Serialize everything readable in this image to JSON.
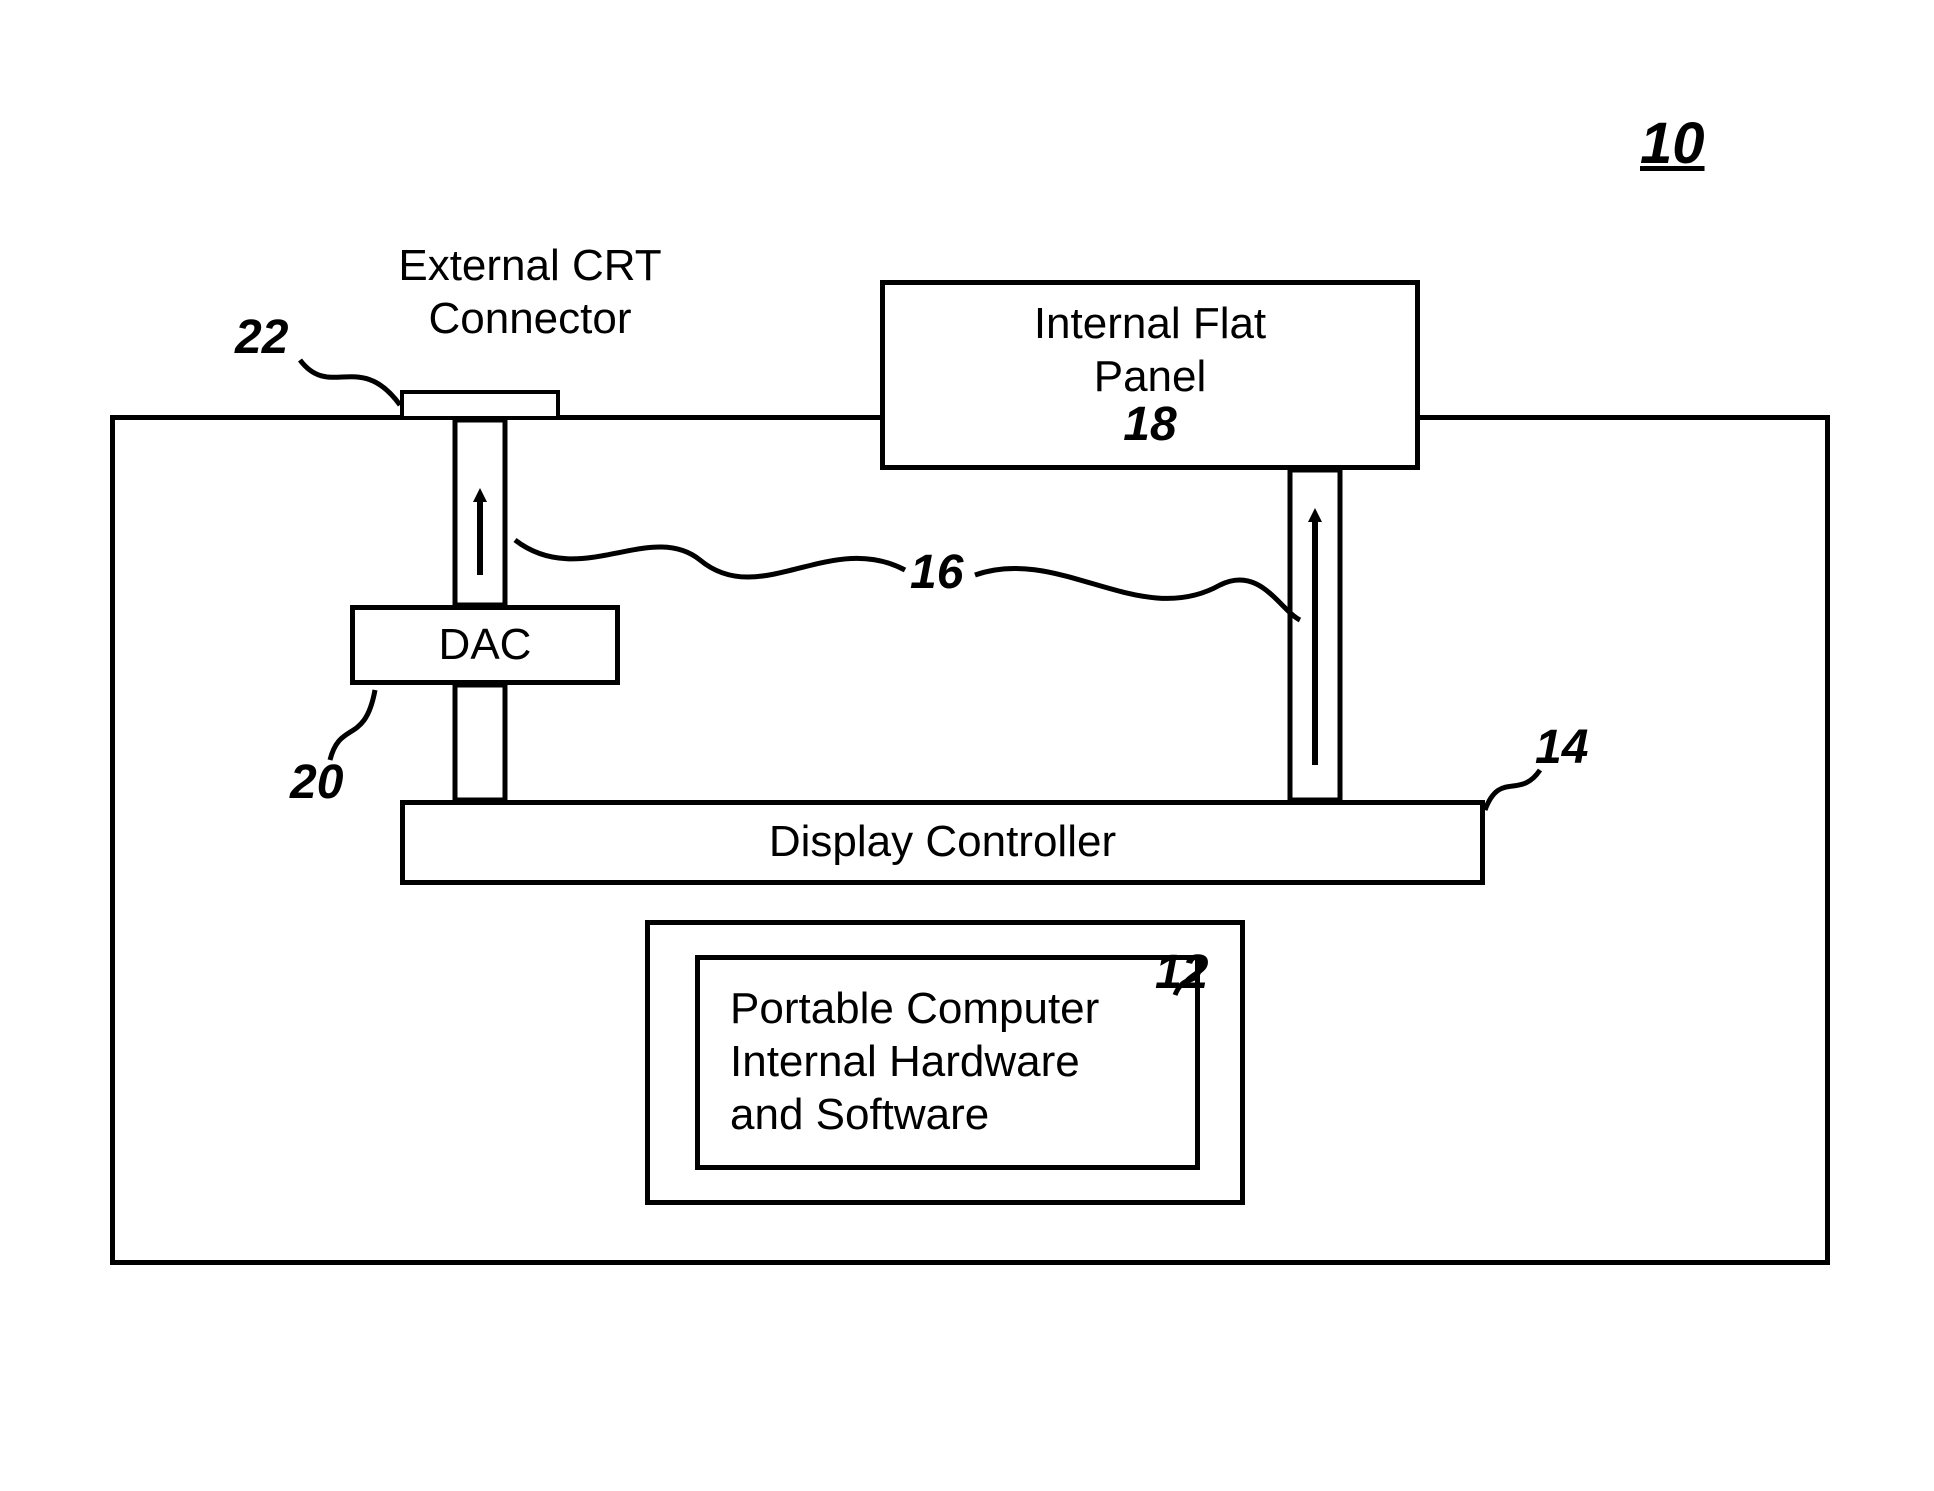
{
  "figure_ref": "10",
  "blocks": {
    "external_crt_connector": {
      "label": "External CRT\nConnector",
      "ref": "22"
    },
    "internal_flat_panel": {
      "label": "Internal Flat\nPanel",
      "ref": "18"
    },
    "dac": {
      "label": "DAC",
      "ref": "20"
    },
    "display_controller": {
      "label": "Display Controller",
      "ref": "14"
    },
    "portable_computer": {
      "label": "Portable Computer\nInternal Hardware\nand Software",
      "ref": "12"
    },
    "signal_ref": "16"
  }
}
